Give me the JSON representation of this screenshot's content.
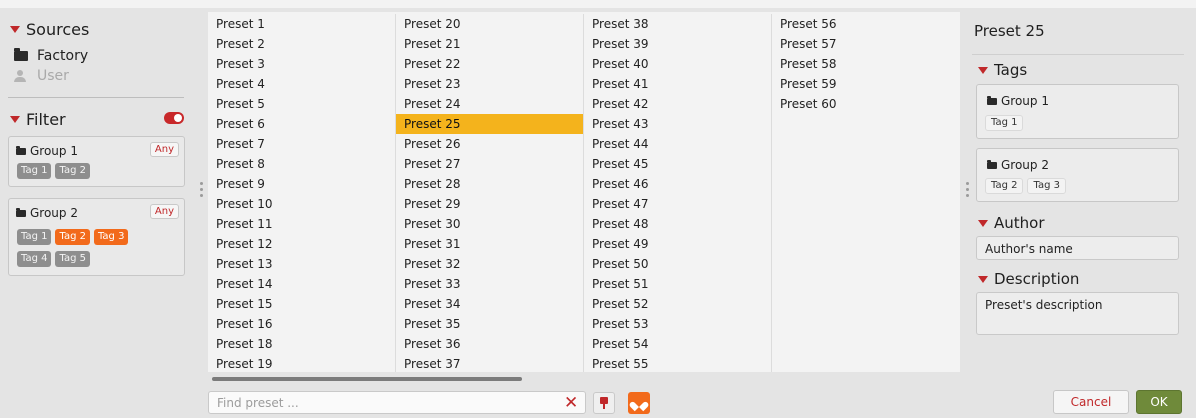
{
  "sources": {
    "title": "Sources",
    "items": [
      {
        "label": "Factory",
        "icon": "folder-icon"
      },
      {
        "label": "User",
        "icon": "user-icon"
      }
    ]
  },
  "filter": {
    "title": "Filter",
    "groups": [
      {
        "name": "Group 1",
        "any_label": "Any",
        "tags": [
          {
            "label": "Tag 1",
            "active": false
          },
          {
            "label": "Tag 2",
            "active": false
          }
        ]
      },
      {
        "name": "Group 2",
        "any_label": "Any",
        "tags": [
          {
            "label": "Tag 1",
            "active": false
          },
          {
            "label": "Tag 2",
            "active": true
          },
          {
            "label": "Tag 3",
            "active": true
          },
          {
            "label": "Tag 4",
            "active": false
          },
          {
            "label": "Tag 5",
            "active": false
          }
        ]
      }
    ]
  },
  "presets": {
    "selected": "Preset 25",
    "columns": [
      [
        "Preset 1",
        "Preset 2",
        "Preset 3",
        "Preset 4",
        "Preset 5",
        "Preset 6",
        "Preset 7",
        "Preset 8",
        "Preset 9",
        "Preset 10",
        "Preset 11",
        "Preset 12",
        "Preset 13",
        "Preset 14",
        "Preset 15",
        "Preset 16",
        "Preset 18",
        "Preset 19"
      ],
      [
        "Preset 20",
        "Preset 21",
        "Preset 22",
        "Preset 23",
        "Preset 24",
        "Preset 25",
        "Preset 26",
        "Preset 27",
        "Preset 28",
        "Preset 29",
        "Preset 30",
        "Preset 31",
        "Preset 32",
        "Preset 33",
        "Preset 34",
        "Preset 35",
        "Preset 36",
        "Preset 37"
      ],
      [
        "Preset 38",
        "Preset 39",
        "Preset 40",
        "Preset 41",
        "Preset 42",
        "Preset 43",
        "Preset 44",
        "Preset 45",
        "Preset 46",
        "Preset 47",
        "Preset 48",
        "Preset 49",
        "Preset 50",
        "Preset 51",
        "Preset 52",
        "Preset 53",
        "Preset 54",
        "Preset 55"
      ],
      [
        "Preset 56",
        "Preset 57",
        "Preset 58",
        "Preset 59",
        "Preset 60"
      ]
    ]
  },
  "search": {
    "placeholder": "Find preset ...",
    "value": ""
  },
  "toolbar": {
    "clear_glyph": "✕"
  },
  "details": {
    "title": "Preset 25",
    "tags_title": "Tags",
    "tag_groups": [
      {
        "name": "Group 1",
        "tags": [
          "Tag 1"
        ]
      },
      {
        "name": "Group 2",
        "tags": [
          "Tag 2",
          "Tag 3"
        ]
      }
    ],
    "author_title": "Author",
    "author_value": "Author's name",
    "description_title": "Description",
    "description_value": "Preset's description"
  },
  "buttons": {
    "cancel": "Cancel",
    "ok": "OK"
  },
  "colors": {
    "accent": "#c0282a",
    "selection": "#f4b31c",
    "active_tag": "#f26a1b",
    "ok": "#6f8a3a"
  }
}
